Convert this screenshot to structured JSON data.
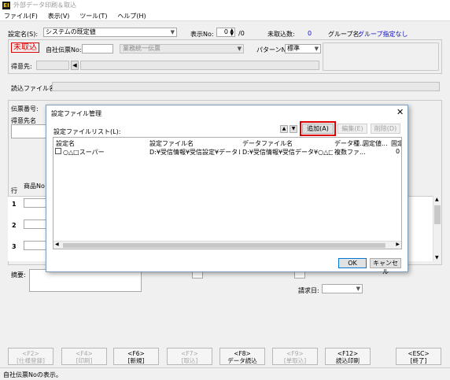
{
  "window": {
    "title": "外部データ印刷＆取込",
    "icon": "EI"
  },
  "menu": [
    "ファイル(F)",
    "表示(V)",
    "ツール(T)",
    "ヘルプ(H)"
  ],
  "header": {
    "settings_label": "設定名(S):",
    "settings_value": "システムの既定値",
    "display_no_label": "表示No:",
    "display_no_value": "0",
    "display_no_total": "/0",
    "untaken_label": "未取込数:",
    "untaken_value": "0",
    "group_label": "グループ名:",
    "group_value": "グループ指定なし"
  },
  "form": {
    "status_badge": "未取込",
    "own_slip_label": "自社伝票No:",
    "business_value": "業務統一伝票",
    "pattern_label": "パターンNo:",
    "pattern_value": "標準",
    "customer_label": "得意先:",
    "read_file_label": "読込ファイル名:",
    "slip_no_label": "伝票番号:",
    "customer_name_label": "得意先名",
    "row_label": "行",
    "product_label": "商品No",
    "row_numbers": [
      "1",
      "2",
      "3"
    ],
    "memo_label": "摘要:",
    "billing_date_label": "請求日:"
  },
  "dialog": {
    "title": "設定ファイル管理",
    "list_label": "設定ファイルリスト(L):",
    "add_button": "追加(A)",
    "edit_button": "編集(E)",
    "delete_button": "削除(D)",
    "columns": [
      "設定名",
      "設定ファイル名",
      "データファイル名",
      "データ種...",
      "固定値...",
      "固定ｲ"
    ],
    "rows": [
      {
        "name": "○△□スーパー",
        "settings_file": "D:¥受信情報¥受信設定¥データレイア...",
        "data_file": "D:¥受信情報¥受信データ¥○△□ス...",
        "type": "複数ファ...",
        "fixed_value": "",
        "fixed_extra": "0"
      }
    ],
    "ok_button": "OK",
    "cancel_button": "キャンセル"
  },
  "function_keys": [
    {
      "key": "<F2>",
      "label": "[仕様登録]",
      "enabled": false
    },
    {
      "key": "<F4>",
      "label": "[印刷]",
      "enabled": false
    },
    {
      "key": "<F6>",
      "label": "[新規]",
      "enabled": true
    },
    {
      "key": "<F7>",
      "label": "[取込]",
      "enabled": false
    },
    {
      "key": "<F8>",
      "label": "データ読込",
      "enabled": true
    },
    {
      "key": "<F9>",
      "label": "[単取込]",
      "enabled": false
    },
    {
      "key": "<F12>",
      "label": "読込印刷",
      "enabled": true
    },
    {
      "key": "<ESC>",
      "label": "[終了]",
      "enabled": true
    }
  ],
  "status": "自社伝票Noの表示。",
  "colors": {
    "badge": "#e00000",
    "accent_blue": "#1010c0",
    "highlight": "#e00000"
  }
}
